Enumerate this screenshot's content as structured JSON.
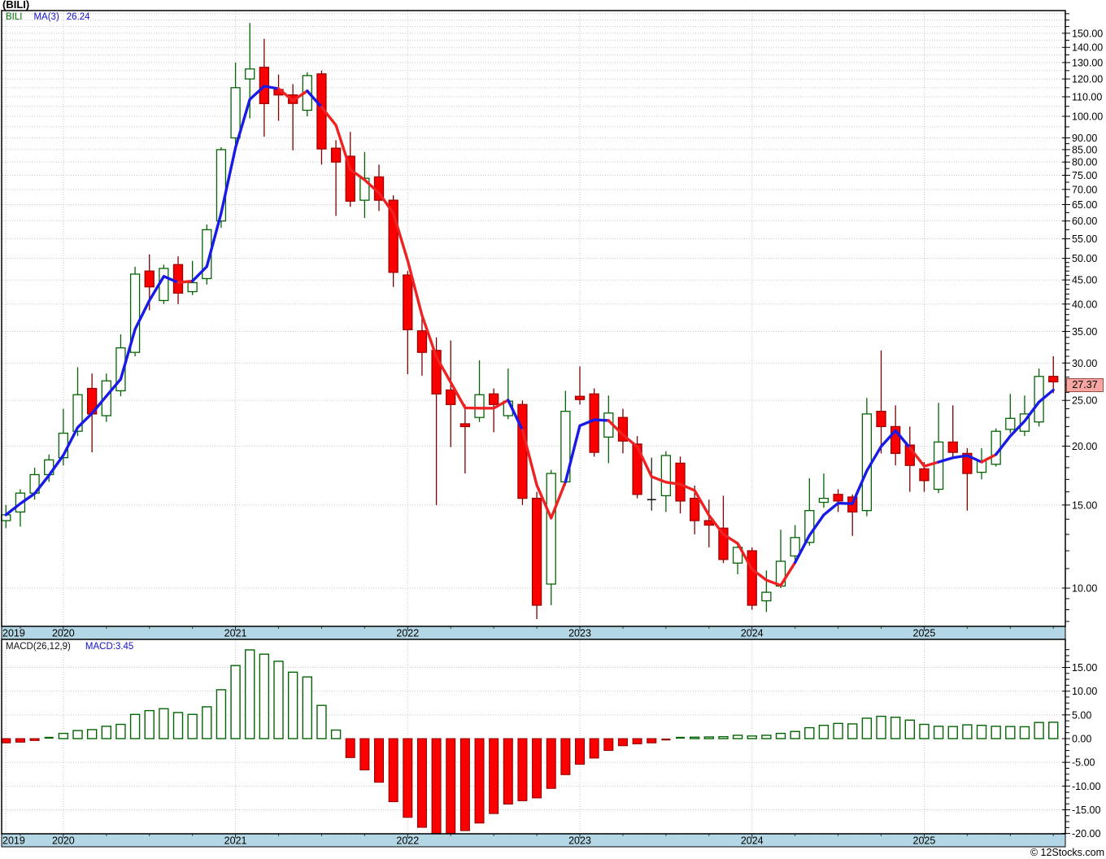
{
  "title": "(BILI)",
  "price_pane": {
    "legend": {
      "symbol": "BILI",
      "ma_label": "MA(3)",
      "ma_value": "26.24"
    },
    "axis_labels": [
      "150.00",
      "140.00",
      "130.00",
      "120.00",
      "110.00",
      "100.00",
      "90.00",
      "85.00",
      "80.00",
      "75.00",
      "70.00",
      "65.00",
      "60.00",
      "55.00",
      "50.00",
      "45.00",
      "40.00",
      "35.00",
      "30.00",
      "25.00",
      "20.00",
      "15.00",
      "10.00"
    ],
    "last_price_label": "27.37"
  },
  "macd_pane": {
    "legend_label": "MACD(26,12,9)",
    "legend_value": "MACD:3.45",
    "axis_labels": [
      "15.00",
      "10.00",
      "5.00",
      "0.00",
      "-5.00",
      "-10.00",
      "-15.00",
      "-20.00"
    ]
  },
  "x_axis": {
    "years": [
      "2019",
      "2020",
      "2021",
      "2022",
      "2023",
      "2024",
      "2025"
    ]
  },
  "footer": "© 12Stocks.com",
  "colors": {
    "candle_up": "#056305",
    "candle_down_body": "#fb0000",
    "candle_down_border": "#a00000",
    "candle_down_wick": "#7b0000",
    "doji": "#111111",
    "ma_up": "#1a1ae6",
    "ma_down": "#ee2222",
    "grid": "#c8c8c8",
    "frame": "#000000",
    "band_fill": "#b3d7e5",
    "macd_pos": "#056305",
    "macd_neg_fill": "#fb0000",
    "macd_neg_border": "#8b0000",
    "last_price_bg": "#f7a6a2"
  },
  "chart_data": [
    {
      "type": "candlestick",
      "title": "BILI monthly price",
      "y_scale": "log",
      "y_axis_range": [
        8.3,
        167
      ],
      "ma_overlay": {
        "name": "MA(3)",
        "period": 3,
        "last_value": 26.24
      },
      "last_price": 27.37,
      "x": [
        "2019-09",
        "2019-10",
        "2019-11",
        "2019-12",
        "2020-01",
        "2020-02",
        "2020-03",
        "2020-04",
        "2020-05",
        "2020-06",
        "2020-07",
        "2020-08",
        "2020-09",
        "2020-10",
        "2020-11",
        "2020-12",
        "2021-01",
        "2021-02",
        "2021-03",
        "2021-04",
        "2021-05",
        "2021-06",
        "2021-07",
        "2021-08",
        "2021-09",
        "2021-10",
        "2021-11",
        "2021-12",
        "2022-01",
        "2022-02",
        "2022-03",
        "2022-04",
        "2022-05",
        "2022-06",
        "2022-07",
        "2022-08",
        "2022-09",
        "2022-10",
        "2022-11",
        "2022-12",
        "2023-01",
        "2023-02",
        "2023-03",
        "2023-04",
        "2023-05",
        "2023-06",
        "2023-07",
        "2023-08",
        "2023-09",
        "2023-10",
        "2023-11",
        "2023-12",
        "2024-01",
        "2024-02",
        "2024-03",
        "2024-04",
        "2024-05",
        "2024-06",
        "2024-07",
        "2024-08",
        "2024-09",
        "2024-10",
        "2024-11",
        "2024-12",
        "2025-01",
        "2025-02",
        "2025-03",
        "2025-04",
        "2025-05",
        "2025-06",
        "2025-07",
        "2025-08",
        "2025-09",
        "2025-10"
      ],
      "ohlc": [
        [
          13.9,
          15.0,
          13.4,
          14.3
        ],
        [
          14.5,
          16.2,
          13.5,
          15.9
        ],
        [
          15.9,
          18.0,
          15.4,
          17.4
        ],
        [
          17.4,
          19.2,
          16.8,
          18.7
        ],
        [
          18.9,
          24.0,
          18.2,
          21.3
        ],
        [
          21.5,
          29.4,
          21.0,
          25.7
        ],
        [
          26.5,
          28.5,
          19.4,
          23.4
        ],
        [
          23.2,
          28.5,
          22.5,
          27.5
        ],
        [
          26.2,
          34.5,
          25.5,
          32.3
        ],
        [
          31.6,
          48.0,
          31.0,
          46.3
        ],
        [
          47.0,
          51.0,
          38.8,
          43.5
        ],
        [
          40.7,
          48.5,
          40.0,
          47.6
        ],
        [
          48.5,
          50.5,
          40.0,
          42.2
        ],
        [
          42.5,
          49.4,
          41.8,
          44.4
        ],
        [
          45.3,
          59.0,
          44.0,
          57.5
        ],
        [
          60.0,
          86.0,
          58.0,
          85.0
        ],
        [
          90.0,
          130.0,
          85.0,
          115.0
        ],
        [
          120.0,
          157.7,
          99.0,
          126.0
        ],
        [
          127.0,
          146.0,
          90.5,
          106.4
        ],
        [
          114.0,
          122.6,
          97.8,
          111.0
        ],
        [
          111.0,
          117.0,
          84.7,
          106.5
        ],
        [
          103.0,
          124.0,
          100.0,
          122.0
        ],
        [
          123.0,
          125.0,
          79.0,
          85.3
        ],
        [
          85.6,
          89.0,
          61.5,
          80.0
        ],
        [
          82.3,
          92.7,
          64.3,
          66.1
        ],
        [
          66.4,
          84.0,
          60.9,
          73.9
        ],
        [
          74.4,
          79.0,
          63.0,
          66.4
        ],
        [
          66.4,
          68.0,
          43.5,
          46.7
        ],
        [
          46.1,
          47.0,
          28.4,
          35.3
        ],
        [
          35.1,
          38.0,
          28.2,
          31.6
        ],
        [
          31.9,
          34.0,
          15.0,
          25.8
        ],
        [
          26.3,
          33.5,
          19.9,
          24.5
        ],
        [
          22.3,
          24.5,
          17.5,
          22.0
        ],
        [
          23.0,
          30.4,
          22.5,
          25.7
        ],
        [
          25.8,
          26.5,
          21.4,
          24.5
        ],
        [
          23.2,
          29.2,
          22.8,
          24.9
        ],
        [
          24.5,
          25.0,
          15.0,
          15.5
        ],
        [
          15.5,
          16.0,
          8.6,
          9.2
        ],
        [
          10.2,
          17.8,
          9.2,
          17.5
        ],
        [
          16.8,
          26.2,
          16.5,
          23.7
        ],
        [
          25.5,
          29.5,
          24.5,
          25.1
        ],
        [
          25.8,
          26.5,
          19.0,
          19.4
        ],
        [
          20.9,
          25.6,
          18.4,
          23.5
        ],
        [
          23.0,
          24.0,
          19.3,
          20.5
        ],
        [
          20.2,
          21.0,
          15.5,
          15.8
        ],
        [
          15.4,
          18.9,
          14.6,
          15.4
        ],
        [
          15.7,
          19.5,
          14.5,
          19.1
        ],
        [
          18.4,
          19.0,
          14.4,
          15.3
        ],
        [
          15.5,
          16.5,
          13.0,
          13.9
        ],
        [
          13.9,
          15.4,
          12.2,
          13.6
        ],
        [
          13.4,
          15.7,
          11.3,
          11.5
        ],
        [
          11.3,
          12.5,
          10.7,
          12.2
        ],
        [
          12.0,
          12.2,
          9.0,
          9.2
        ],
        [
          9.4,
          10.9,
          8.9,
          9.8
        ],
        [
          10.1,
          13.3,
          10.0,
          11.4
        ],
        [
          11.7,
          13.6,
          11.3,
          12.8
        ],
        [
          12.5,
          17.1,
          12.3,
          14.6
        ],
        [
          15.2,
          17.5,
          14.8,
          15.5
        ],
        [
          15.8,
          16.2,
          14.5,
          15.3
        ],
        [
          15.6,
          15.8,
          12.9,
          14.5
        ],
        [
          14.6,
          25.3,
          14.2,
          23.4
        ],
        [
          23.7,
          31.9,
          19.3,
          22.0
        ],
        [
          22.0,
          24.4,
          18.2,
          19.3
        ],
        [
          20.1,
          22.0,
          16.0,
          18.2
        ],
        [
          17.9,
          18.5,
          16.0,
          16.9
        ],
        [
          16.2,
          24.7,
          15.9,
          20.4
        ],
        [
          20.4,
          24.4,
          19.0,
          19.4
        ],
        [
          19.3,
          19.8,
          14.6,
          17.5
        ],
        [
          17.6,
          19.8,
          17.0,
          18.6
        ],
        [
          18.3,
          21.8,
          18.1,
          21.5
        ],
        [
          21.7,
          25.8,
          21.3,
          22.9
        ],
        [
          21.5,
          25.6,
          21.0,
          23.4
        ],
        [
          22.5,
          29.2,
          22.0,
          28.1
        ],
        [
          28.1,
          31.0,
          25.9,
          27.37
        ]
      ]
    },
    {
      "type": "bar",
      "title": "MACD(26,12,9) histogram",
      "ylim": [
        -20,
        15
      ],
      "last_value": 3.45,
      "values": [
        -0.9,
        -0.75,
        -0.4,
        0.05,
        1.1,
        1.7,
        1.9,
        2.6,
        3.0,
        5.1,
        5.9,
        6.3,
        5.5,
        5.1,
        6.7,
        10.3,
        15.4,
        18.7,
        17.8,
        16.3,
        14.0,
        13.0,
        7.0,
        1.8,
        -4.0,
        -6.6,
        -9.2,
        -13.3,
        -16.6,
        -18.7,
        -20.0,
        -20.3,
        -19.4,
        -17.8,
        -15.8,
        -13.8,
        -13.1,
        -12.5,
        -10.5,
        -7.6,
        -5.4,
        -4.1,
        -2.5,
        -1.5,
        -1.1,
        -0.9,
        -0.15,
        0.15,
        0.3,
        0.35,
        0.4,
        0.7,
        0.55,
        0.7,
        1.1,
        1.5,
        2.3,
        2.8,
        3.2,
        3.1,
        4.3,
        4.7,
        4.5,
        3.9,
        3.0,
        2.6,
        2.55,
        2.9,
        2.8,
        2.6,
        2.55,
        2.5,
        3.4,
        3.45
      ]
    }
  ]
}
